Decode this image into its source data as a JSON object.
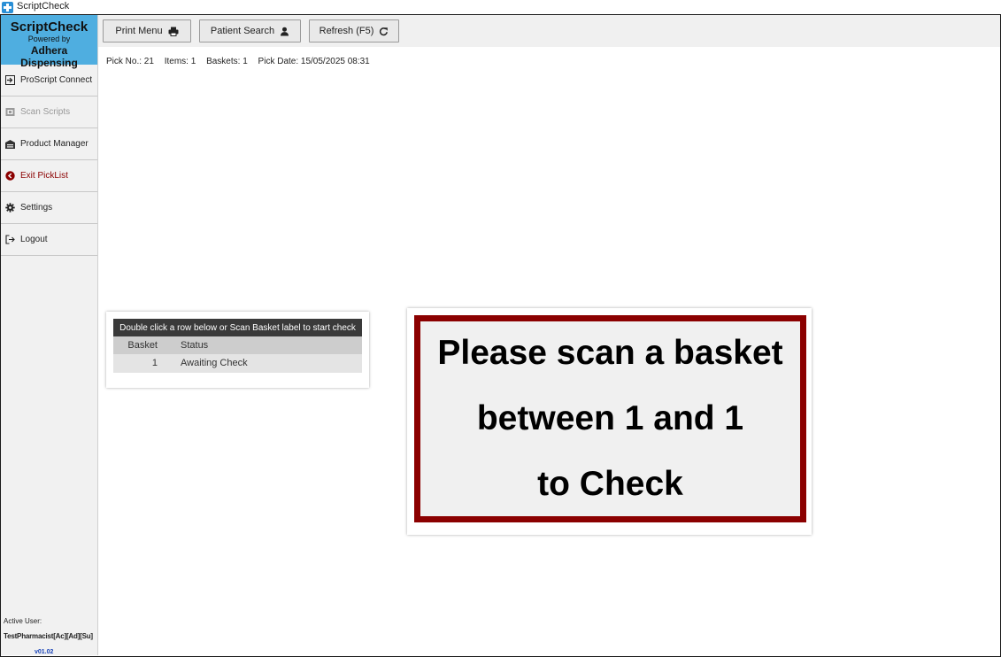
{
  "window": {
    "title": "ScriptCheck"
  },
  "brand": {
    "name": "ScriptCheck",
    "powered_by": "Powered by",
    "company": "Adhera Dispensing"
  },
  "sidebar": {
    "items": [
      {
        "label": "ProScript Connect",
        "icon": "sign-in-icon",
        "state": "enabled"
      },
      {
        "label": "Scan Scripts",
        "icon": "scan-icon",
        "state": "disabled"
      },
      {
        "label": "Product Manager",
        "icon": "warehouse-icon",
        "state": "enabled"
      },
      {
        "label": "Exit PickList",
        "icon": "back-circle-icon",
        "state": "enabled"
      },
      {
        "label": "Settings",
        "icon": "gear-icon",
        "state": "enabled"
      },
      {
        "label": "Logout",
        "icon": "logout-icon",
        "state": "enabled"
      }
    ],
    "active_user_label": "Active User:",
    "active_user_value": "TestPharmacist[Ac][Ad][Su]",
    "version": "v01.02"
  },
  "toolbar": {
    "print_menu": "Print Menu",
    "patient_search": "Patient Search",
    "refresh": "Refresh (F5)"
  },
  "pick_info": {
    "pick_no": "Pick No.: 21",
    "items": "Items: 1",
    "baskets": "Baskets: 1",
    "pick_date": "Pick Date: 15/05/2025 08:31"
  },
  "basket_table": {
    "header": "Double click a row below or Scan Basket label to start check",
    "columns": [
      "Basket",
      "Status"
    ],
    "rows": [
      {
        "basket": "1",
        "status": "Awaiting Check"
      }
    ]
  },
  "scan_prompt": {
    "line1": "Please scan a basket",
    "line2": "between 1 and 1",
    "line3": "to Check"
  },
  "colors": {
    "brand_bg": "#4faee0",
    "prompt_border": "#8b0000",
    "exit_text": "#8b0000",
    "table_header_bg": "#3a3a3a"
  }
}
